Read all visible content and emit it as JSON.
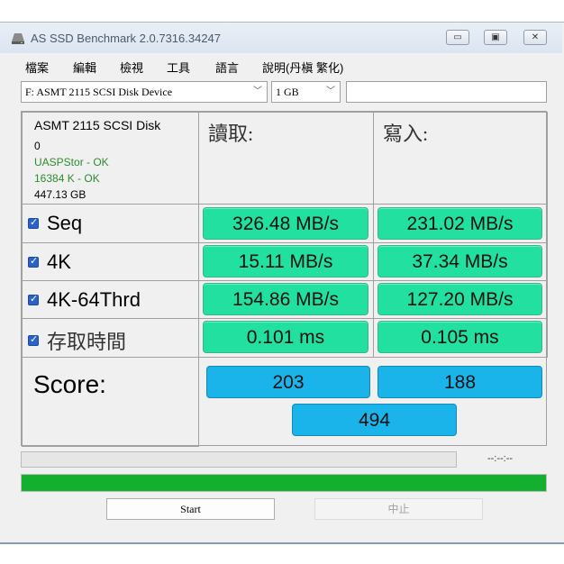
{
  "window": {
    "title": "AS SSD Benchmark 2.0.7316.34247",
    "minimize": "▭",
    "maximize": "▣",
    "close": "✕"
  },
  "menu": [
    "檔案",
    "編輯",
    "檢視",
    "工具",
    "語言",
    "說明(丹槇 繁化)"
  ],
  "drive_select": {
    "value": "F: ASMT 2115 SCSI Disk Device"
  },
  "size_select": {
    "value": "1 GB"
  },
  "text_field": {
    "value": ""
  },
  "device_info": {
    "name": "ASMT 2115 SCSI Disk",
    "line2": "0",
    "driver": "UASPStor - OK",
    "alignment": "16384 K - OK",
    "capacity": "447.13 GB"
  },
  "headers": {
    "read": "讀取:",
    "write": "寫入:"
  },
  "rows": [
    {
      "label": "Seq",
      "read": "326.48 MB/s",
      "write": "231.02 MB/s",
      "checked": true
    },
    {
      "label": "4K",
      "read": "15.11 MB/s",
      "write": "37.34 MB/s",
      "checked": true
    },
    {
      "label": "4K-64Thrd",
      "read": "154.86 MB/s",
      "write": "127.20 MB/s",
      "checked": true
    },
    {
      "label": "存取時間",
      "read": "0.101 ms",
      "write": "0.105 ms",
      "checked": true
    }
  ],
  "score": {
    "label": "Score:",
    "read": "203",
    "write": "188",
    "total": "494"
  },
  "progress": {
    "time": "--:--:--",
    "small_fraction": 0,
    "big_fraction": 1.0
  },
  "buttons": {
    "start": "Start",
    "stop": "中止"
  },
  "colors": {
    "result_green": "#22e0a0",
    "score_blue": "#1ab4ea",
    "progress_green": "#12b02e"
  },
  "icons": {
    "app": "disk-icon"
  }
}
